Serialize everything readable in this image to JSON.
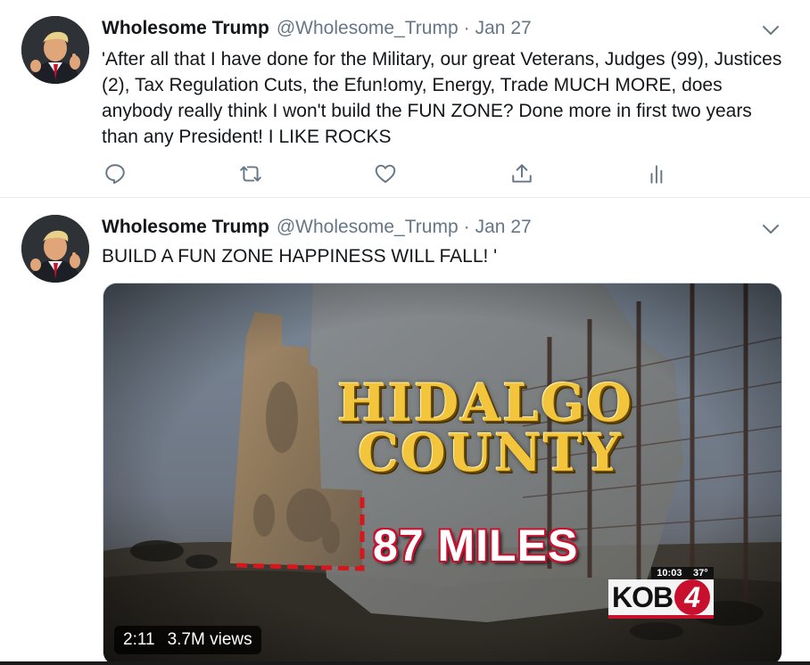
{
  "tweets": [
    {
      "display_name": "Wholesome Trump",
      "handle": "@Wholesome_Trump",
      "separator": "·",
      "date": "Jan 27",
      "text": "'After all that I have done for the Military, our great Veterans, Judges (99), Justices (2), Tax  Regulation Cuts, the Efun!omy, Energy, Trade  MUCH MORE, does anybody really think I won't build the FUN ZONE? Done more in first two years than any President! I LIKE ROCKS",
      "actions": [
        "reply-icon",
        "retweet-icon",
        "like-icon",
        "share-icon",
        "analytics-icon"
      ]
    },
    {
      "display_name": "Wholesome Trump",
      "handle": "@Wholesome_Trump",
      "separator": "·",
      "date": "Jan 27",
      "text": "BUILD A FUN ZONE  HAPPINESS WILL FALL! '",
      "video": {
        "title_line_1": "HIDALGO",
        "title_line_2": "COUNTY",
        "miles_text": "87 MILES",
        "station_time": "10:03",
        "station_temp": "37°",
        "station_name": "KOB",
        "station_number": "4",
        "duration": "2:11",
        "views": "3.7M views"
      }
    }
  ],
  "colors": {
    "text_primary": "#14171a",
    "text_secondary": "#657786",
    "divider": "#e6ecf0",
    "title_gold": "#f2c53d",
    "accent_red": "#c8102e"
  }
}
